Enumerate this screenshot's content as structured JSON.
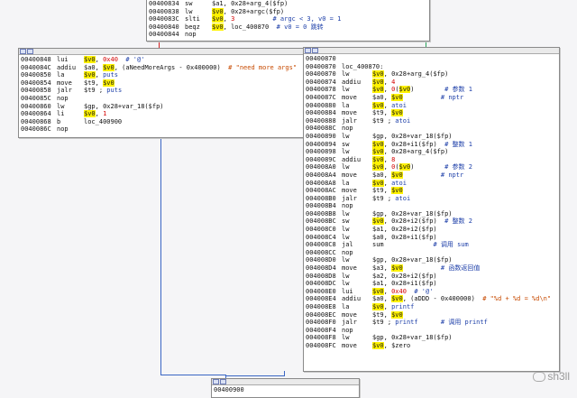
{
  "nodes": {
    "top": {
      "lines": [
        {
          "addr": "00400834",
          "mn": "sw",
          "ops": [
            {
              "t": "$a1, 0x28+arg_4($fp)",
              "c": "plain"
            }
          ]
        },
        {
          "addr": "00400838",
          "mn": "lw",
          "ops": [
            {
              "t": "$v0",
              "c": "reg"
            },
            {
              "t": ", 0x28+argc($fp)",
              "c": "plain"
            }
          ]
        },
        {
          "addr": "0040083C",
          "mn": "slti",
          "ops": [
            {
              "t": "$v0",
              "c": "reg"
            },
            {
              "t": ", ",
              "c": "plain"
            },
            {
              "t": "3",
              "c": "num"
            },
            {
              "t": "          # argc < 3, v0 = 1",
              "c": "cmt"
            }
          ]
        },
        {
          "addr": "00400840",
          "mn": "beqz",
          "ops": [
            {
              "t": "$v0",
              "c": "reg"
            },
            {
              "t": ", loc_400870  ",
              "c": "plain"
            },
            {
              "t": "# v0 = 0 跳转",
              "c": "cmt"
            }
          ]
        },
        {
          "addr": "00400844",
          "mn": "nop",
          "ops": []
        }
      ]
    },
    "left": {
      "lines": [
        {
          "addr": "00400848",
          "mn": "lui",
          "ops": [
            {
              "t": "$v0",
              "c": "reg"
            },
            {
              "t": ", ",
              "c": "plain"
            },
            {
              "t": "0x40",
              "c": "num"
            },
            {
              "t": "  # '@'",
              "c": "cmt"
            }
          ]
        },
        {
          "addr": "0040084C",
          "mn": "addiu",
          "ops": [
            {
              "t": "$a0, ",
              "c": "plain"
            },
            {
              "t": "$v0",
              "c": "reg"
            },
            {
              "t": ", (aNeedMoreArgs - 0x400000)  ",
              "c": "plain"
            },
            {
              "t": "# \"need more args\"",
              "c": "str"
            }
          ]
        },
        {
          "addr": "00400850",
          "mn": "la",
          "ops": [
            {
              "t": "$v0",
              "c": "reg"
            },
            {
              "t": ", ",
              "c": "plain"
            },
            {
              "t": "puts",
              "c": "sym"
            }
          ]
        },
        {
          "addr": "00400854",
          "mn": "move",
          "ops": [
            {
              "t": "$t9, ",
              "c": "plain"
            },
            {
              "t": "$v0",
              "c": "reg"
            }
          ]
        },
        {
          "addr": "00400858",
          "mn": "jalr",
          "ops": [
            {
              "t": "$t9 ; ",
              "c": "plain"
            },
            {
              "t": "puts",
              "c": "sym"
            }
          ]
        },
        {
          "addr": "0040085C",
          "mn": "nop",
          "ops": []
        },
        {
          "addr": "00400860",
          "mn": "lw",
          "ops": [
            {
              "t": "$gp, 0x28+var_18($fp)",
              "c": "plain"
            }
          ]
        },
        {
          "addr": "00400864",
          "mn": "li",
          "ops": [
            {
              "t": "$v0",
              "c": "reg"
            },
            {
              "t": ", ",
              "c": "plain"
            },
            {
              "t": "1",
              "c": "num"
            }
          ]
        },
        {
          "addr": "00400868",
          "mn": "b",
          "ops": [
            {
              "t": "loc_400900",
              "c": "plain"
            }
          ]
        },
        {
          "addr": "0040086C",
          "mn": "nop",
          "ops": []
        }
      ]
    },
    "right": {
      "lines": [
        {
          "addr": "00400870",
          "mn": "",
          "ops": []
        },
        {
          "addr": "00400870",
          "mn": "loc_400870:",
          "ops": []
        },
        {
          "addr": "00400870",
          "mn": "lw",
          "ops": [
            {
              "t": "$v0",
              "c": "reg"
            },
            {
              "t": ", 0x28+arg_4($fp)",
              "c": "plain"
            }
          ]
        },
        {
          "addr": "00400874",
          "mn": "addiu",
          "ops": [
            {
              "t": "$v0",
              "c": "reg"
            },
            {
              "t": ", ",
              "c": "plain"
            },
            {
              "t": "4",
              "c": "num"
            }
          ]
        },
        {
          "addr": "00400878",
          "mn": "lw",
          "ops": [
            {
              "t": "$v0",
              "c": "reg"
            },
            {
              "t": ", ",
              "c": "plain"
            },
            {
              "t": "0",
              "c": "num"
            },
            {
              "t": "(",
              "c": "plain"
            },
            {
              "t": "$v0",
              "c": "reg"
            },
            {
              "t": ")        ",
              "c": "plain"
            },
            {
              "t": "# 参数 1",
              "c": "cmt"
            }
          ]
        },
        {
          "addr": "0040087C",
          "mn": "move",
          "ops": [
            {
              "t": "$a0, ",
              "c": "plain"
            },
            {
              "t": "$v0",
              "c": "reg"
            },
            {
              "t": "          ",
              "c": "plain"
            },
            {
              "t": "# nptr",
              "c": "cmt"
            }
          ]
        },
        {
          "addr": "00400880",
          "mn": "la",
          "ops": [
            {
              "t": "$v0",
              "c": "reg"
            },
            {
              "t": ", ",
              "c": "plain"
            },
            {
              "t": "atoi",
              "c": "sym"
            }
          ]
        },
        {
          "addr": "00400884",
          "mn": "move",
          "ops": [
            {
              "t": "$t9, ",
              "c": "plain"
            },
            {
              "t": "$v0",
              "c": "reg"
            }
          ]
        },
        {
          "addr": "00400888",
          "mn": "jalr",
          "ops": [
            {
              "t": "$t9 ; ",
              "c": "plain"
            },
            {
              "t": "atoi",
              "c": "sym"
            }
          ]
        },
        {
          "addr": "0040088C",
          "mn": "nop",
          "ops": []
        },
        {
          "addr": "00400890",
          "mn": "lw",
          "ops": [
            {
              "t": "$gp, 0x28+var_18($fp)",
              "c": "plain"
            }
          ]
        },
        {
          "addr": "00400894",
          "mn": "sw",
          "ops": [
            {
              "t": "$v0",
              "c": "reg"
            },
            {
              "t": ", 0x28+i1($fp)  ",
              "c": "plain"
            },
            {
              "t": "# 整数 1",
              "c": "cmt"
            }
          ]
        },
        {
          "addr": "00400898",
          "mn": "lw",
          "ops": [
            {
              "t": "$v0",
              "c": "reg"
            },
            {
              "t": ", 0x28+arg_4($fp)",
              "c": "plain"
            }
          ]
        },
        {
          "addr": "0040089C",
          "mn": "addiu",
          "ops": [
            {
              "t": "$v0",
              "c": "reg"
            },
            {
              "t": ", ",
              "c": "plain"
            },
            {
              "t": "8",
              "c": "num"
            }
          ]
        },
        {
          "addr": "004008A0",
          "mn": "lw",
          "ops": [
            {
              "t": "$v0",
              "c": "reg"
            },
            {
              "t": ", ",
              "c": "plain"
            },
            {
              "t": "0",
              "c": "num"
            },
            {
              "t": "(",
              "c": "plain"
            },
            {
              "t": "$v0",
              "c": "reg"
            },
            {
              "t": ")        ",
              "c": "plain"
            },
            {
              "t": "# 参数 2",
              "c": "cmt"
            }
          ]
        },
        {
          "addr": "004008A4",
          "mn": "move",
          "ops": [
            {
              "t": "$a0, ",
              "c": "plain"
            },
            {
              "t": "$v0",
              "c": "reg"
            },
            {
              "t": "          ",
              "c": "plain"
            },
            {
              "t": "# nptr",
              "c": "cmt"
            }
          ]
        },
        {
          "addr": "004008A8",
          "mn": "la",
          "ops": [
            {
              "t": "$v0",
              "c": "reg"
            },
            {
              "t": ", ",
              "c": "plain"
            },
            {
              "t": "atoi",
              "c": "sym"
            }
          ]
        },
        {
          "addr": "004008AC",
          "mn": "move",
          "ops": [
            {
              "t": "$t9, ",
              "c": "plain"
            },
            {
              "t": "$v0",
              "c": "reg"
            }
          ]
        },
        {
          "addr": "004008B0",
          "mn": "jalr",
          "ops": [
            {
              "t": "$t9 ; ",
              "c": "plain"
            },
            {
              "t": "atoi",
              "c": "sym"
            }
          ]
        },
        {
          "addr": "004008B4",
          "mn": "nop",
          "ops": []
        },
        {
          "addr": "004008B8",
          "mn": "lw",
          "ops": [
            {
              "t": "$gp, 0x28+var_18($fp)",
              "c": "plain"
            }
          ]
        },
        {
          "addr": "004008BC",
          "mn": "sw",
          "ops": [
            {
              "t": "$v0",
              "c": "reg"
            },
            {
              "t": ", 0x28+i2($fp)  ",
              "c": "plain"
            },
            {
              "t": "# 整数 2",
              "c": "cmt"
            }
          ]
        },
        {
          "addr": "004008C0",
          "mn": "lw",
          "ops": [
            {
              "t": "$a1, 0x28+i2($fp)",
              "c": "plain"
            }
          ]
        },
        {
          "addr": "004008C4",
          "mn": "lw",
          "ops": [
            {
              "t": "$a0, 0x28+i1($fp)",
              "c": "plain"
            }
          ]
        },
        {
          "addr": "004008C8",
          "mn": "jal",
          "ops": [
            {
              "t": "sum             ",
              "c": "plain"
            },
            {
              "t": "# 调用 sum",
              "c": "cmt"
            }
          ]
        },
        {
          "addr": "004008CC",
          "mn": "nop",
          "ops": []
        },
        {
          "addr": "004008D0",
          "mn": "lw",
          "ops": [
            {
              "t": "$gp, 0x28+var_18($fp)",
              "c": "plain"
            }
          ]
        },
        {
          "addr": "004008D4",
          "mn": "move",
          "ops": [
            {
              "t": "$a3, ",
              "c": "plain"
            },
            {
              "t": "$v0",
              "c": "reg"
            },
            {
              "t": "          ",
              "c": "plain"
            },
            {
              "t": "# 函数返回值",
              "c": "cmt"
            }
          ]
        },
        {
          "addr": "004008D8",
          "mn": "lw",
          "ops": [
            {
              "t": "$a2, 0x28+i2($fp)",
              "c": "plain"
            }
          ]
        },
        {
          "addr": "004008DC",
          "mn": "lw",
          "ops": [
            {
              "t": "$a1, 0x28+i1($fp)",
              "c": "plain"
            }
          ]
        },
        {
          "addr": "004008E0",
          "mn": "lui",
          "ops": [
            {
              "t": "$v0",
              "c": "reg"
            },
            {
              "t": ", ",
              "c": "plain"
            },
            {
              "t": "0x40",
              "c": "num"
            },
            {
              "t": "  # '@'",
              "c": "cmt"
            }
          ]
        },
        {
          "addr": "004008E4",
          "mn": "addiu",
          "ops": [
            {
              "t": "$a0, ",
              "c": "plain"
            },
            {
              "t": "$v0",
              "c": "reg"
            },
            {
              "t": ", (aDDD - 0x400000)  ",
              "c": "plain"
            },
            {
              "t": "# \"%d + %d = %d\\n\"",
              "c": "str"
            }
          ]
        },
        {
          "addr": "004008E8",
          "mn": "la",
          "ops": [
            {
              "t": "$v0",
              "c": "reg"
            },
            {
              "t": ", ",
              "c": "plain"
            },
            {
              "t": "printf",
              "c": "sym"
            }
          ]
        },
        {
          "addr": "004008EC",
          "mn": "move",
          "ops": [
            {
              "t": "$t9, ",
              "c": "plain"
            },
            {
              "t": "$v0",
              "c": "reg"
            }
          ]
        },
        {
          "addr": "004008F0",
          "mn": "jalr",
          "ops": [
            {
              "t": "$t9 ; ",
              "c": "plain"
            },
            {
              "t": "printf",
              "c": "sym"
            },
            {
              "t": "      ",
              "c": "plain"
            },
            {
              "t": "# 调用 printf",
              "c": "cmt"
            }
          ]
        },
        {
          "addr": "004008F4",
          "mn": "nop",
          "ops": []
        },
        {
          "addr": "004008F8",
          "mn": "lw",
          "ops": [
            {
              "t": "$gp, 0x28+var_18($fp)",
              "c": "plain"
            }
          ]
        },
        {
          "addr": "004008FC",
          "mn": "move",
          "ops": [
            {
              "t": "$v0",
              "c": "reg"
            },
            {
              "t": ", $zero",
              "c": "plain"
            }
          ]
        }
      ]
    },
    "bottom": {
      "lines": [
        {
          "addr": "00400900",
          "mn": "",
          "ops": []
        }
      ]
    }
  },
  "watermark": {
    "text": "sh3ll"
  },
  "colors": {
    "edge_blue": "#3a66c4",
    "edge_green": "#27a35a",
    "edge_red": "#d21f1f",
    "reg_highlight": "#fff200"
  }
}
